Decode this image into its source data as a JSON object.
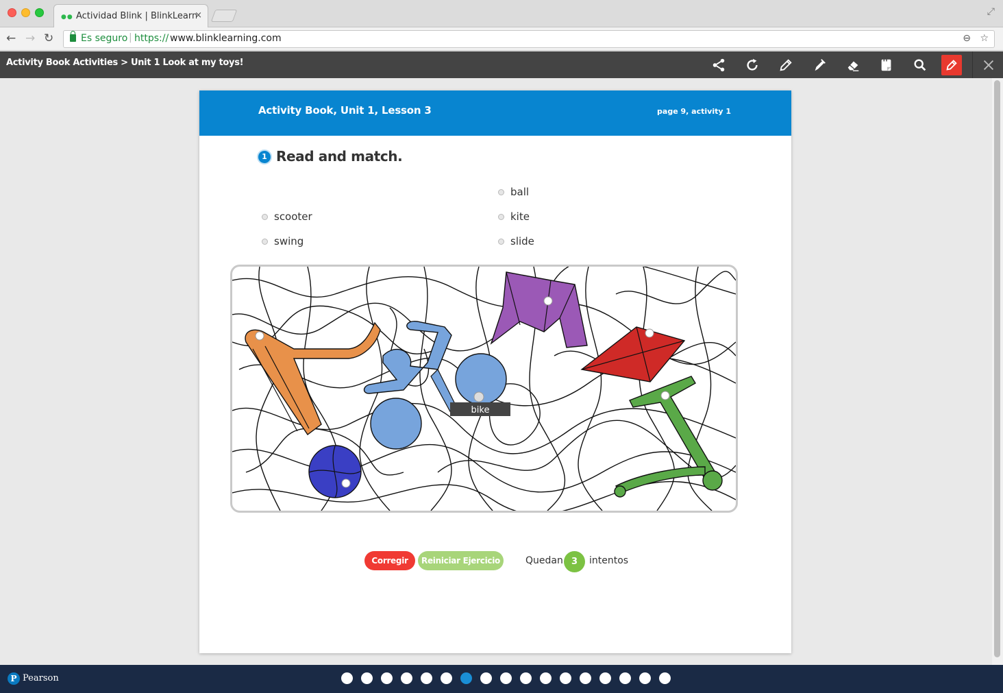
{
  "browser": {
    "tab_title": "Actividad Blink | BlinkLearning",
    "tab_close": "×",
    "secure_label": "Es seguro",
    "url_scheme": "https://",
    "url_host": "www.blinklearning.com"
  },
  "toolbar": {
    "breadcrumb": "Activity Book Activities > Unit 1 Look at my toys!"
  },
  "page": {
    "lesson_title": "Activity Book, Unit 1, Lesson 3",
    "page_ref": "page 9, activity 1",
    "activity_number": "1",
    "instruction": "Read and match."
  },
  "words": {
    "ball": "ball",
    "scooter": "scooter",
    "kite": "kite",
    "swing": "swing",
    "slide": "slide"
  },
  "picture": {
    "matched_label": "bike",
    "colors": {
      "slide": "#e8914a",
      "bike": "#77a4dc",
      "swing": "#9b59b6",
      "kite": "#cf2a27",
      "scooter": "#5aa948",
      "ball": "#3a3fc4"
    }
  },
  "controls": {
    "correct_label": "Corregir",
    "reset_label": "Reiniciar Ejercicio",
    "tries_prefix": "Quedan",
    "tries_count": "3",
    "tries_suffix": "intentos"
  },
  "footer": {
    "logo_letter": "P",
    "brand": "Pearson",
    "total_pages": 17,
    "current_page": 7
  },
  "colors": {
    "header_blue": "#0885d0",
    "toolbar_bg": "#444444",
    "footer_bg": "#1a2a45",
    "correct_red": "#f03a33",
    "reset_green": "#a8d57a",
    "tries_green": "#7cc243"
  }
}
